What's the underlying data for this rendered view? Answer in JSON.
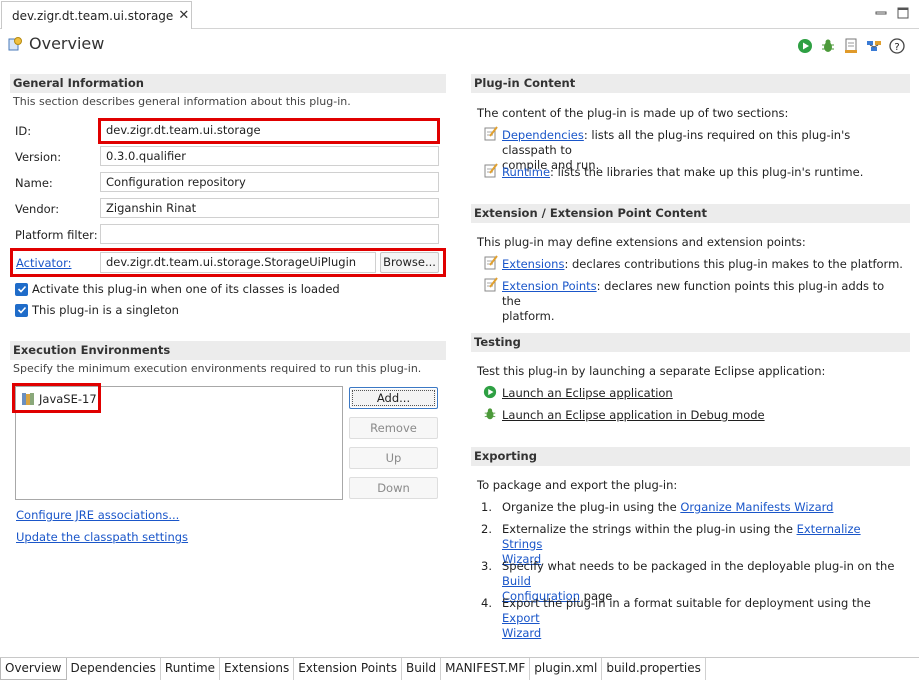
{
  "editor_tab": {
    "label": "dev.zigr.dt.team.ui.storage"
  },
  "header": {
    "title": "Overview"
  },
  "general": {
    "heading": "General Information",
    "description": "This section describes general information about this plug-in.",
    "id_label": "ID:",
    "id_value": "dev.zigr.dt.team.ui.storage",
    "version_label": "Version:",
    "version_value": "0.3.0.qualifier",
    "name_label": "Name:",
    "name_value": "Configuration repository",
    "vendor_label": "Vendor:",
    "vendor_value": "Ziganshin Rinat",
    "platform_label": "Platform filter:",
    "platform_value": "",
    "activator_label": "Activator:",
    "activator_value": "dev.zigr.dt.team.ui.storage.StorageUiPlugin",
    "browse_label": "Browse...",
    "check_activate": "Activate this plug-in when one of its classes is loaded",
    "check_singleton": "This plug-in is a singleton"
  },
  "exec_env": {
    "heading": "Execution Environments",
    "description": "Specify the minimum execution environments required to run this plug-in.",
    "items": [
      "JavaSE-17"
    ],
    "add_label": "Add...",
    "remove_label": "Remove",
    "up_label": "Up",
    "down_label": "Down",
    "configure_link": "Configure JRE associations...",
    "update_link": "Update the classpath settings"
  },
  "plugin_content": {
    "heading": "Plug-in Content",
    "intro": "The content of the plug-in is made up of two sections:",
    "dependencies_link": "Dependencies",
    "dependencies_text_1": ": lists all the plug-ins required on this plug-in's classpath to",
    "dependencies_text_2": "compile and run.",
    "runtime_link": "Runtime",
    "runtime_text": ": lists the libraries that make up this plug-in's runtime."
  },
  "extension_content": {
    "heading": "Extension / Extension Point Content",
    "intro": "This plug-in may define extensions and extension points:",
    "extensions_link": "Extensions",
    "extensions_text": ": declares contributions this plug-in makes to the platform.",
    "points_link": "Extension Points",
    "points_text_1": ": declares new function points this plug-in adds to the",
    "points_text_2": "platform."
  },
  "testing": {
    "heading": "Testing",
    "intro": "Test this plug-in by launching a separate Eclipse application:",
    "launch_link": "Launch an Eclipse application",
    "debug_link": "Launch an Eclipse application in Debug mode"
  },
  "exporting": {
    "heading": "Exporting",
    "intro": "To package and export the plug-in:",
    "step1_num": "1.",
    "step1_text": "Organize the plug-in using the ",
    "step1_link": "Organize Manifests Wizard",
    "step2_num": "2.",
    "step2_text": "Externalize the strings within the plug-in using the ",
    "step2_link_1": "Externalize Strings",
    "step2_link_2": "Wizard",
    "step3_num": "3.",
    "step3_text": "Specify what needs to be packaged in the deployable plug-in on the ",
    "step3_link_1": "Build",
    "step3_link_2": "Configuration",
    "step3_tail": " page",
    "step4_num": "4.",
    "step4_text": "Export the plug-in in a format suitable for deployment using the ",
    "step4_link_1": "Export",
    "step4_link_2": "Wizard"
  },
  "bottom_tabs": [
    "Overview",
    "Dependencies",
    "Runtime",
    "Extensions",
    "Extension Points",
    "Build",
    "MANIFEST.MF",
    "plugin.xml",
    "build.properties"
  ],
  "colors": {
    "link": "#1a56c9",
    "highlight": "#e00000",
    "checkbox": "#1f6cc9"
  }
}
